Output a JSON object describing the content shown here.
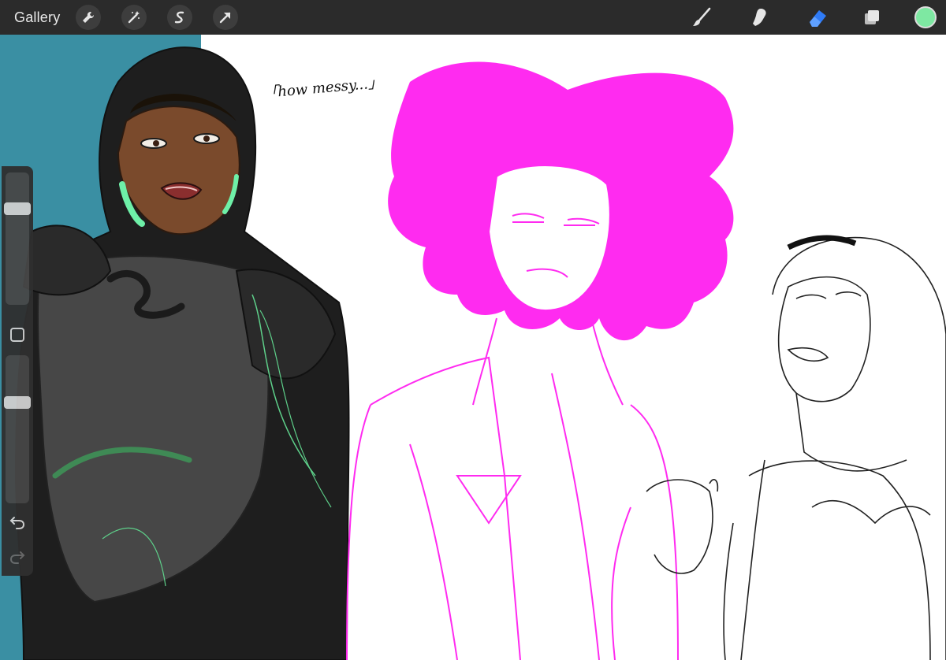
{
  "toolbar": {
    "gallery_label": "Gallery",
    "left_tools": [
      "wrench-icon",
      "magic-wand-icon",
      "selection-icon",
      "transform-arrow-icon"
    ],
    "right_tools": [
      "brush-icon",
      "smudge-icon",
      "eraser-icon",
      "layers-icon"
    ],
    "active_tool": "eraser",
    "current_color": "#7ee8a2"
  },
  "sidebar": {
    "brush_size": 0.75,
    "opacity": 0.7
  },
  "canvas": {
    "annotation_text": "「how messy...」",
    "colors": {
      "teal_background": "#3a8fa3",
      "magenta_sketch": "#ff2bf0",
      "armor_dark": "#3c3c3c",
      "accent_green": "#6ef0a8"
    }
  }
}
